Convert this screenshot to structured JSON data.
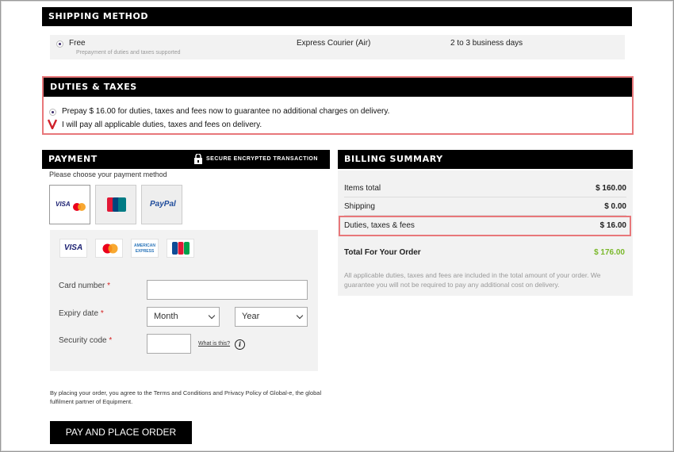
{
  "shipping": {
    "title": "SHIPPING METHOD",
    "option_price": "Free",
    "option_note": "Prepayment of duties and taxes supported",
    "carrier": "Express Courier (Air)",
    "eta": "2 to 3 business days"
  },
  "duties": {
    "title": "DUTIES & TAXES",
    "option_prepay": "Prepay $ 16.00 for duties, taxes and fees now to guarantee no additional charges on delivery.",
    "option_pay_on_delivery": "I will pay all applicable duties, taxes and fees on delivery.",
    "marker_color": "#d0212a"
  },
  "payment": {
    "title": "PAYMENT",
    "secure_label": "SECURE ENCRYPTED TRANSACTION",
    "choose_label": "Please choose your payment method",
    "methods": [
      "VISA",
      "UnionPay",
      "PayPal"
    ],
    "cards": [
      "VISA",
      "MasterCard",
      "AMERICAN EXPRESS",
      "JCB"
    ],
    "card_number_label": "Card number",
    "expiry_label": "Expiry date",
    "month_placeholder": "Month",
    "year_placeholder": "Year",
    "security_label": "Security code",
    "what_is_this": "What is this?",
    "required_mark": "*",
    "terms": "By placing your order, you agree to the Terms and Conditions and Privacy Policy of Global-e, the global fulfilment partner of Equipment.",
    "submit_label": "PAY AND PLACE ORDER"
  },
  "billing": {
    "title": "BILLING SUMMARY",
    "rows": [
      {
        "label": "Items total",
        "value": "$ 160.00"
      },
      {
        "label": "Shipping",
        "value": "$ 0.00"
      },
      {
        "label": "Duties, taxes & fees",
        "value": "$ 16.00"
      }
    ],
    "total_label": "Total For Your Order",
    "total_value": "$ 176.00",
    "total_color": "#7ab82a",
    "note": "All applicable duties, taxes and fees are included in the total amount of your order. We guarantee you will not be required to pay any additional cost on delivery."
  },
  "highlight_color": "#e8777a"
}
